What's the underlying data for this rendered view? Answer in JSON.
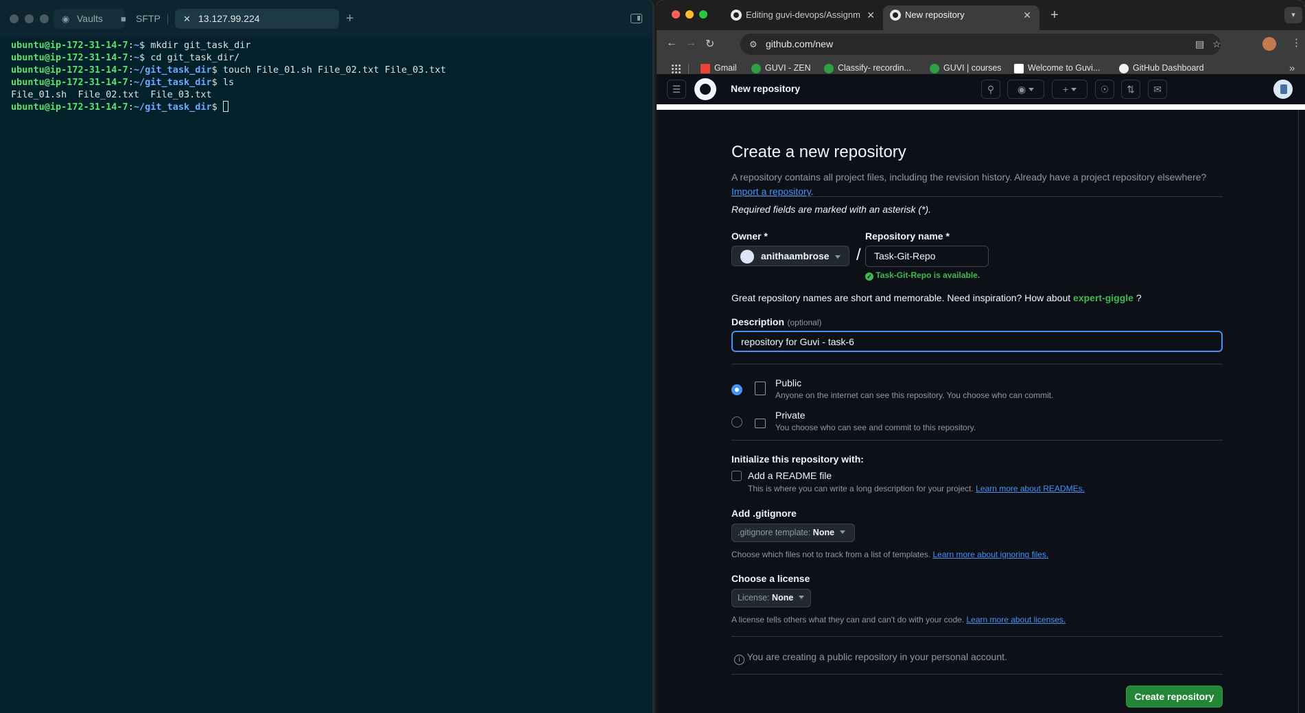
{
  "terminal": {
    "tabs": {
      "vaults": "Vaults",
      "sftp": "SFTP",
      "host": "13.127.99.224"
    },
    "lines": [
      {
        "user": "ubuntu@ip-172-31-14-7",
        "path": "~",
        "cmd": "mkdir git_task_dir"
      },
      {
        "user": "ubuntu@ip-172-31-14-7",
        "path": "~",
        "cmd": "cd git_task_dir/"
      },
      {
        "user": "ubuntu@ip-172-31-14-7",
        "path": "~/git_task_dir",
        "cmd": "touch File_01.sh File_02.txt File_03.txt"
      },
      {
        "user": "ubuntu@ip-172-31-14-7",
        "path": "~/git_task_dir",
        "cmd": "ls"
      },
      {
        "output": "File_01.sh  File_02.txt  File_03.txt"
      },
      {
        "user": "ubuntu@ip-172-31-14-7",
        "path": "~/git_task_dir",
        "cmd": ""
      }
    ]
  },
  "browser": {
    "tabs": [
      {
        "title": "Editing guvi-devops/Assignm"
      },
      {
        "title": "New repository"
      }
    ],
    "url": "github.com/new",
    "bookmarks": [
      {
        "label": "Gmail",
        "color": "#ea4335"
      },
      {
        "label": "GUVI - ZEN",
        "color": "#2ea043"
      },
      {
        "label": "Classify- recordin...",
        "color": "#2ea043"
      },
      {
        "label": "GUVI | courses",
        "color": "#2ea043"
      },
      {
        "label": "Welcome to Guvi...",
        "color": "#ffffff"
      },
      {
        "label": "GitHub Dashboard",
        "color": "#f0f0f0"
      }
    ]
  },
  "github": {
    "header_title": "New repository",
    "page_title": "Create a new repository",
    "intro": "A repository contains all project files, including the revision history. Already have a project repository elsewhere?",
    "import_link": "Import a repository",
    "required_note": "Required fields are marked with an asterisk (*).",
    "owner_label": "Owner *",
    "owner_value": "anithaambrose",
    "repo_label": "Repository name *",
    "repo_value": "Task-Git-Repo",
    "availability": "Task-Git-Repo is available.",
    "inspiration": "Great repository names are short and memorable. Need inspiration? How about",
    "suggestion": "expert-giggle",
    "suggestion_end": "?",
    "description_label": "Description",
    "description_optional": "(optional)",
    "description_value": "repository for Guvi - task-6",
    "public_label": "Public",
    "public_desc": "Anyone on the internet can see this repository. You choose who can commit.",
    "private_label": "Private",
    "private_desc": "You choose who can see and commit to this repository.",
    "init_label": "Initialize this repository with:",
    "readme_label": "Add a README file",
    "readme_desc": "This is where you can write a long description for your project.",
    "readme_link": "Learn more about READMEs.",
    "gitignore_label": "Add .gitignore",
    "gitignore_prefix": ".gitignore template:",
    "gitignore_value": "None",
    "gitignore_desc": "Choose which files not to track from a list of templates.",
    "gitignore_link": "Learn more about ignoring files.",
    "license_label": "Choose a license",
    "license_prefix": "License:",
    "license_value": "None",
    "license_desc": "A license tells others what they can and can't do with your code.",
    "license_link": "Learn more about licenses.",
    "public_notice": "You are creating a public repository in your personal account.",
    "create_button": "Create repository",
    "accent": "#238636",
    "link_color": "#4493f8"
  }
}
